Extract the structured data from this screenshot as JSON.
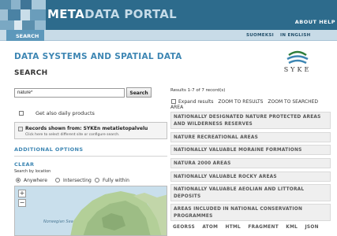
{
  "header": {
    "brand_part1": "META",
    "brand_part2": "DATA PORTAL",
    "about": "ABOUT HELP"
  },
  "nav": {
    "search_tab": "SEARCH",
    "lang_fi": "SUOMEKSI",
    "lang_en": "IN ENGLISH"
  },
  "page": {
    "title": "DATA SYSTEMS AND SPATIAL DATA",
    "logo_text": "SYKE"
  },
  "search": {
    "heading": "SEARCH",
    "query": "nature*",
    "button": "Search",
    "daily_products_label": "Get also daily products",
    "records_title": "Records shown from: SYKEn metatietopalvelu",
    "records_hint": "Click here to select different site or configure search.",
    "additional_options": "ADDITIONAL OPTIONS",
    "clear": "CLEAR",
    "search_by_location": "Search by location",
    "location_options": [
      "Anywhere",
      "Intersecting",
      "Fully within"
    ],
    "location_selected": "Anywhere",
    "map_label": "Norwegian Sea"
  },
  "results": {
    "count_text": "Results 1-7 of 7 record(s)",
    "expand_results": "Expand results",
    "zoom_to_results": "ZOOM TO RESULTS",
    "zoom_to_searched": "ZOOM TO SEARCHED",
    "area_word": "AREA",
    "items": [
      "NATIONALLY DESIGNATED NATURE PROTECTED AREAS AND WILDERNESS RESERVES",
      "NATURE RECREATIONAL AREAS",
      "NATIONALLY VALUABLE MORAINE FORMATIONS",
      "NATURA 2000 AREAS",
      "NATIONALLY VALUABLE ROCKY AREAS",
      "NATIONALLY VALUABLE AEOLIAN AND LITTORAL DEPOSITS",
      "AREAS INCLUDED IN NATIONAL CONSERVATION PROGRAMMES"
    ],
    "formats": [
      "GEORSS",
      "ATOM",
      "HTML",
      "FRAGMENT",
      "KML",
      "JSON"
    ]
  },
  "colors": {
    "header_bg": "#2d6b8c",
    "nav_bg": "#c8dbe7",
    "accent": "#3d86b3",
    "result_bg": "#efefef"
  }
}
